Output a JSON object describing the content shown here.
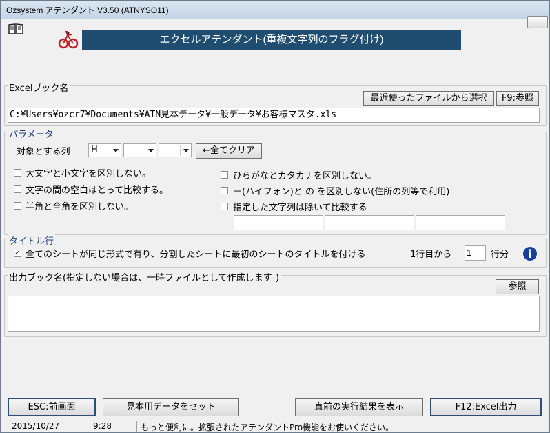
{
  "window": {
    "title": "Ozsystem アテンダント V3.50 (ATNYSO11)"
  },
  "banner": {
    "title": "エクセルアテンダント(重複文字列のフラグ付け)"
  },
  "excel_book": {
    "label": "Excelブック名",
    "recent_button": "最近使ったファイルから選択",
    "browse_button": "F9:参照",
    "path": "C:¥Users¥ozcr7¥Documents¥ATN見本データ¥一般データ¥お客様マスタ.xls"
  },
  "params": {
    "label": "パラメータ",
    "target_columns_label": "対象とする列",
    "col1": "H",
    "col2": "",
    "col3": "",
    "clear_button": "←全てクリア",
    "opt_case": "大文字と小文字を区別しない。",
    "opt_space": "文字の間の空白はとって比較する。",
    "opt_width": "半角と全角を区別しない。",
    "opt_kana": "ひらがなとカタカナを区別しない。",
    "opt_hyphen": "－(ハイフォン)と の を区別しない(住所の列等で利用)",
    "opt_exclude": "指定した文字列は除いて比較する"
  },
  "title_row": {
    "label": "タイトル行",
    "opt_same_format": "全てのシートが同じ形式で有り、分割したシートに最初のシートのタイトルを付ける",
    "from_label": "1行目から",
    "row_count": "1",
    "unit_label": "行分"
  },
  "output_book": {
    "label": "出力ブック名(指定しない場合は、一時ファイルとして作成します。)",
    "browse_button": "参照",
    "path": ""
  },
  "footer": {
    "esc_button": "ESC:前画面",
    "sample_button": "見本用データをセット",
    "last_result_button": "直前の実行結果を表示",
    "run_button": "F12:Excel出力"
  },
  "status": {
    "date": "2015/10/27",
    "time": "9:28",
    "message": "もっと便利に。拡張されたアテンダントPro機能をお使いください。"
  },
  "colors": {
    "banner": "#1f4d6f",
    "accent": "#2d4e7a"
  }
}
